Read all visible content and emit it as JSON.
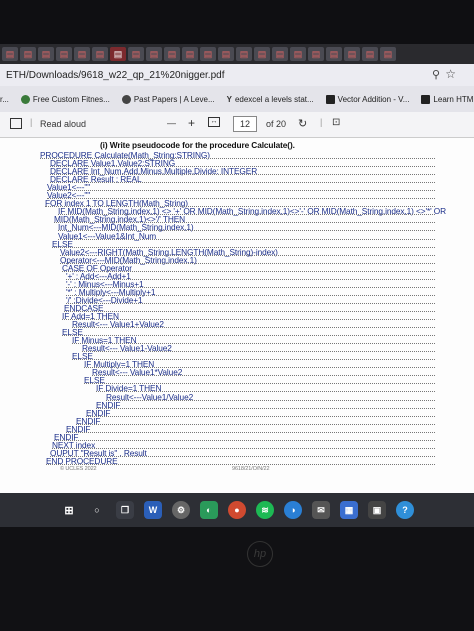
{
  "browser": {
    "url": "ETH/Downloads/9618_w22_qp_21%20nigger.pdf",
    "bookmarks": [
      {
        "label": "r..."
      },
      {
        "label": "Free Custom Fitnes..."
      },
      {
        "label": "Past Papers | A Leve..."
      },
      {
        "label": "edexcel a levels stat..."
      },
      {
        "label": "Vector Addition - V..."
      },
      {
        "label": "Learn HTML - F"
      }
    ]
  },
  "pdf_toolbar": {
    "read_aloud": "Read aloud",
    "minus": "—",
    "plus": "+",
    "page": "12",
    "page_of": "of 20"
  },
  "document": {
    "question": "(i)   Write pseudocode for the procedure Calculate().",
    "code": [
      "PROCEDURE  Calculate(Math_String:STRING)",
      "DECLARE  Value1,Value2:STRING",
      "DECLARE  Int_Num,Add,Minus,Multiple,Divide: INTEGER",
      "DECLARE  Result ; REAL",
      "Value1<---\"\"",
      "Value2<---\"\"",
      "FOR index 1 TO LENGTH(Math_String)",
      "IF MID(Math_String,index,1) <> '+' OR MID(Math_String,index,1)<>'-' OR MID(Math_String,index,1) <>'*' OR",
      "MID(Math_String,index,1)<>'/' THEN",
      "Int_Num<---MID(Math_String,index,1)",
      "Value1<---Value1&Int_Num",
      "ELSE",
      "Value2<---RIGHT(Math_String,LENGTH(Math_String)-index)",
      "Operator<---MID(Math_String,index,1)",
      "CASE OF Operator",
      "'+' : Add<---Add+1",
      "'-' : Minus<---Minus+1",
      "'*' : Multiply<---Multiply+1",
      "'/' :Divide<---Divide+1",
      "ENDCASE",
      "IF  Add=1  THEN",
      "Result<--- Value1+Value2",
      "ELSE",
      "IF  Minus=1  THEN",
      "Result<--- Value1-Value2",
      "ELSE",
      "IF  Multiply=1  THEN",
      "Result<--- Value1*Value2",
      "ELSE",
      "IF  Divide=1  THEN",
      "Result<---Value1/Value2",
      "ENDIF",
      "ENDIF",
      "ENDIF",
      "ENDIF",
      "ENDIF",
      "NEXT index",
      "OUPUT  \"Result is\" , Result",
      "END PROCEDURE"
    ],
    "footer_left": "© UCLES 2022",
    "footer_center": "9618/21/O/N/22"
  },
  "colors": {
    "code_text": "#1c2f8a",
    "page_bg": "#fdfdfd",
    "taskbar_bg": "#2d2f35"
  },
  "taskbar": {
    "icons": [
      "windows-icon",
      "search-icon",
      "task-view-icon",
      "word-icon",
      "settings-icon",
      "edge-icon",
      "chrome-icon",
      "spotify-icon",
      "edge-blue-icon",
      "mail-icon",
      "store-icon",
      "photos-icon",
      "help-icon"
    ]
  }
}
